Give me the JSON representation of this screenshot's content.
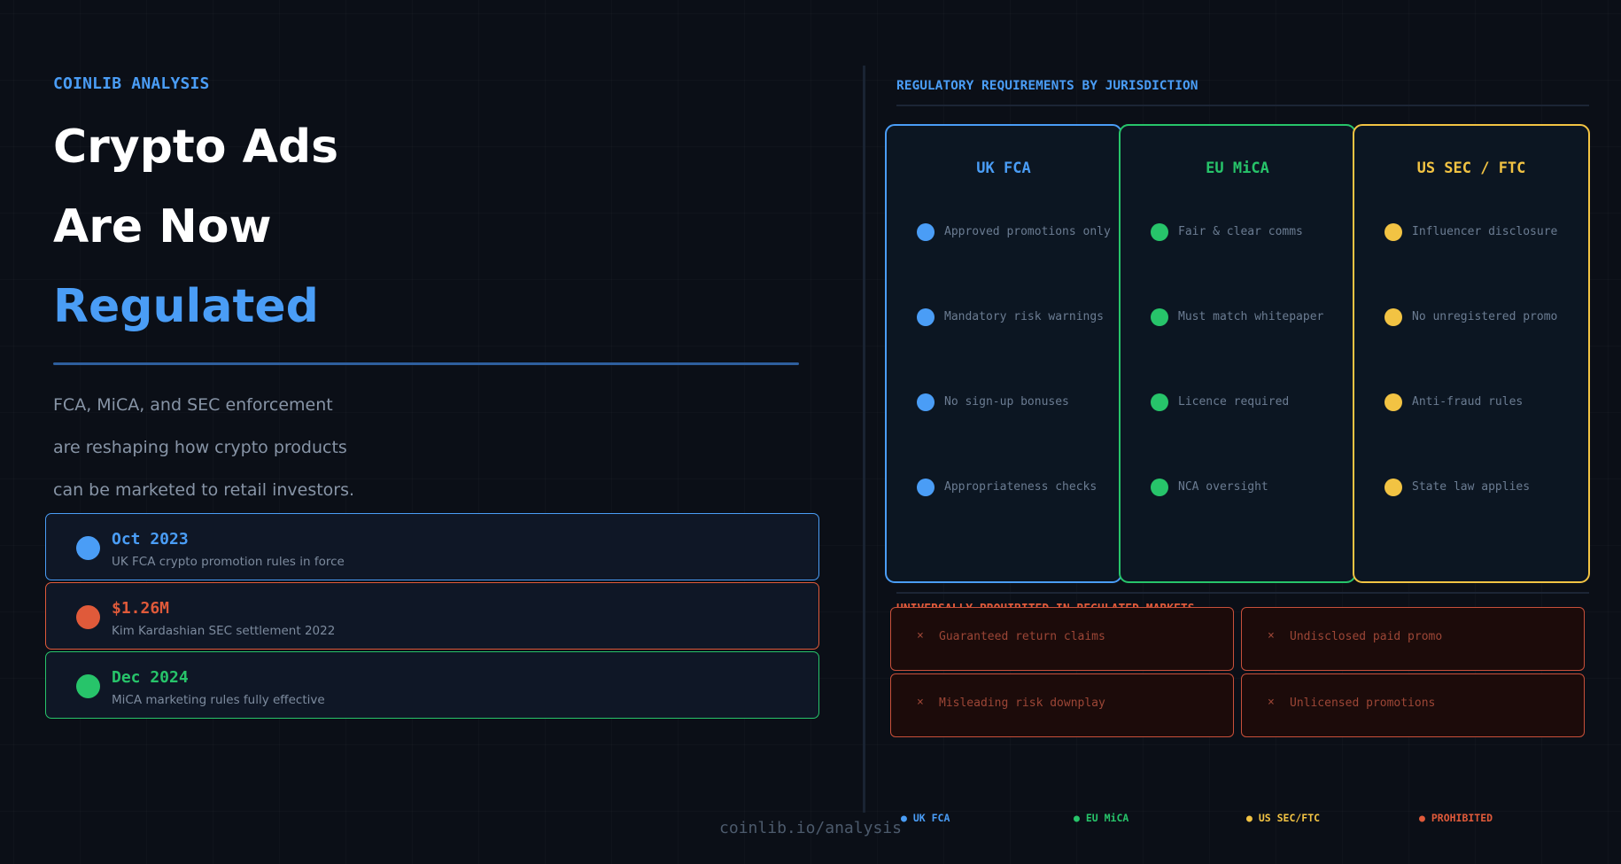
{
  "brand": "COINLIB ANALYSIS",
  "title": {
    "line1": "Crypto Ads",
    "line2": "Are Now",
    "line3": "Regulated"
  },
  "subtitle": {
    "line1": "FCA, MiCA, and SEC enforcement",
    "line2": "are reshaping how crypto products",
    "line3": "can be marketed to retail investors."
  },
  "stats": [
    {
      "value": "Oct 2023",
      "label": "UK FCA crypto promotion rules in force",
      "color": "#4a9df6"
    },
    {
      "value": "$1.26M",
      "label": "Kim Kardashian SEC settlement 2022",
      "color": "#e05a3a"
    },
    {
      "value": "Dec 2024",
      "label": "MiCA marketing rules fully effective",
      "color": "#27c46a"
    }
  ],
  "requirements_heading": "REGULATORY REQUIREMENTS BY JURISDICTION",
  "jurisdictions": [
    {
      "name": "UK FCA",
      "color": "#4a9df6",
      "items": [
        "Approved promotions only",
        "Mandatory risk warnings",
        "No sign-up bonuses",
        "Appropriateness checks"
      ]
    },
    {
      "name": "EU MiCA",
      "color": "#27c46a",
      "items": [
        "Fair & clear comms",
        "Must match whitepaper",
        "Licence required",
        "NCA oversight"
      ]
    },
    {
      "name": "US SEC / FTC",
      "color": "#f2c343",
      "items": [
        "Influencer disclosure",
        "No unregistered promo",
        "Anti-fraud rules",
        "State law applies"
      ]
    }
  ],
  "prohibited": {
    "heading": "UNIVERSALLY PROHIBITED IN REGULATED MARKETS",
    "color": "#e05a3a",
    "items": [
      "Guaranteed return claims",
      "Undisclosed paid promo",
      "Misleading risk downplay",
      "Unlicensed promotions"
    ],
    "mark": "×"
  },
  "legend": [
    {
      "label": "● UK FCA",
      "color": "#4a9df6"
    },
    {
      "label": "● EU MiCA",
      "color": "#27c46a"
    },
    {
      "label": "● US SEC/FTC",
      "color": "#f2c343"
    },
    {
      "label": "● PROHIBITED",
      "color": "#e05a3a"
    }
  ],
  "footer": "coinlib.io/analysis"
}
